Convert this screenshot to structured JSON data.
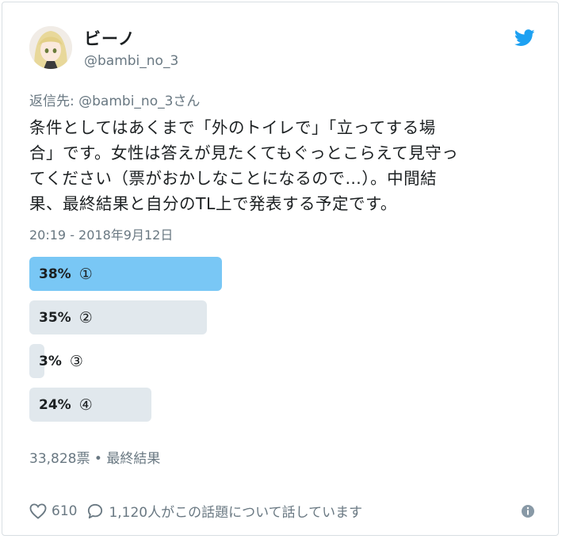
{
  "author": {
    "display_name": "ビーノ",
    "handle": "@bambi_no_3"
  },
  "icons": {
    "brand": "twitter-bird-icon",
    "like": "heart-icon",
    "reply": "speech-bubble-icon",
    "info": "info-icon"
  },
  "colors": {
    "brand_blue": "#1da1f2",
    "winner_bar": "#79c7f5",
    "other_bar": "#e1e8ed",
    "muted_text": "#697882"
  },
  "tweet": {
    "reply_to": "返信先: @bambi_no_3さん",
    "text": "条件としてはあくまで「外のトイレで」「立ってする場\n合」です。女性は答えが見たくてもぐっとこらえて見守っ\nてください（票がおかしなことになるので…）。中間結\n果、最終結果と自分のTL上で発表する予定です。",
    "timestamp": "20:19 - 2018年9月12日"
  },
  "poll": {
    "options": [
      {
        "percent_label": "38%",
        "choice": "①",
        "value": 38,
        "winner": true
      },
      {
        "percent_label": "35%",
        "choice": "②",
        "value": 35,
        "winner": false
      },
      {
        "percent_label": "3%",
        "choice": "③",
        "value": 3,
        "winner": false
      },
      {
        "percent_label": "24%",
        "choice": "④",
        "value": 24,
        "winner": false
      }
    ],
    "footer": "33,828票 • 最終結果"
  },
  "engagement": {
    "likes": "610",
    "replies_text": "1,120人がこの話題について話しています"
  }
}
